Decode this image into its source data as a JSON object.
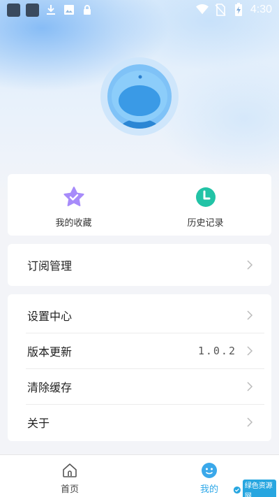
{
  "status_bar": {
    "time": "4:30",
    "left_icons": [
      "app-icon",
      "app-icon",
      "download-icon",
      "image-icon",
      "lock-icon"
    ],
    "right_icons": [
      "wifi-icon",
      "no-sim-icon",
      "battery-charging-icon"
    ]
  },
  "profile": {
    "avatar_icon": "robot-avatar-icon"
  },
  "favorites": {
    "items": [
      {
        "label": "我的收藏",
        "icon": "star-check-icon",
        "color": "#a78bfa"
      },
      {
        "label": "历史记录",
        "icon": "clock-icon",
        "color": "#22c3a6"
      }
    ]
  },
  "subscription": {
    "label": "订阅管理"
  },
  "settings": {
    "items": [
      {
        "label": "设置中心",
        "value": ""
      },
      {
        "label": "版本更新",
        "value": "1.0.2"
      },
      {
        "label": "清除缓存",
        "value": ""
      },
      {
        "label": "关于",
        "value": ""
      }
    ]
  },
  "bottom_nav": {
    "items": [
      {
        "label": "首页",
        "icon": "home-icon",
        "active": false
      },
      {
        "label": "我的",
        "icon": "mine-face-icon",
        "active": true
      }
    ],
    "active_color": "#2fa8e8"
  },
  "watermark": {
    "text": "绿色资源网"
  }
}
